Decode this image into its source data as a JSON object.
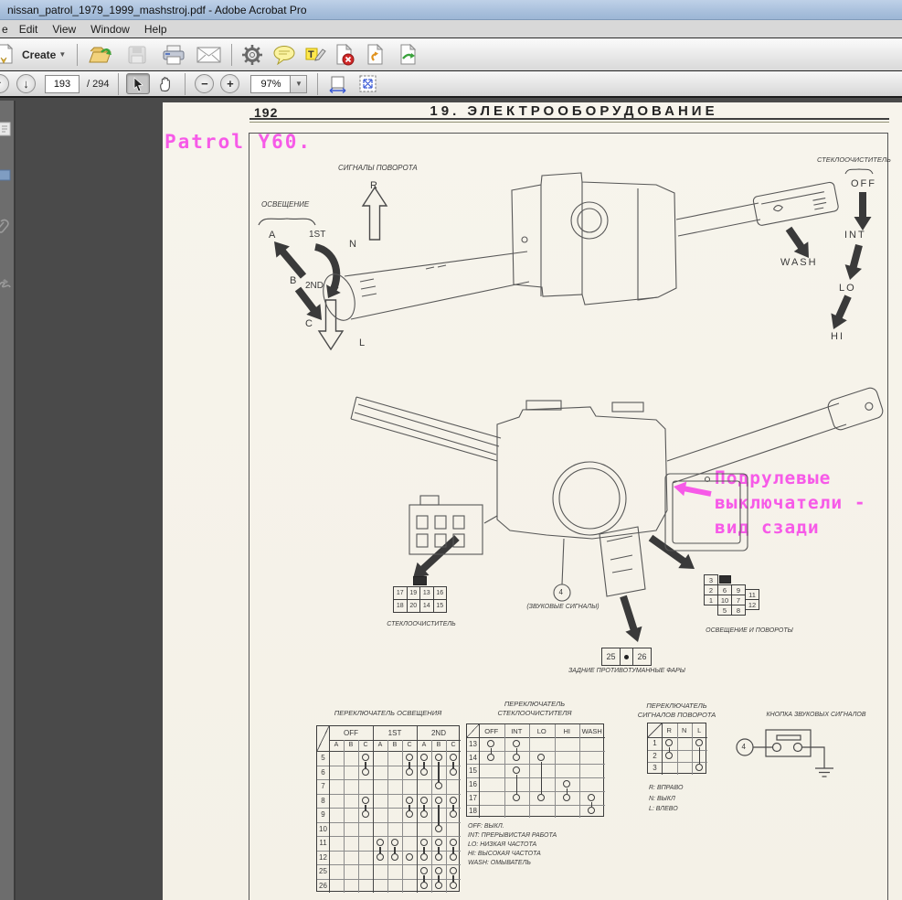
{
  "window": {
    "title": "nissan_patrol_1979_1999_mashstroj.pdf - Adobe Acrobat Pro"
  },
  "menu": {
    "items": [
      "e",
      "Edit",
      "View",
      "Window",
      "Help"
    ]
  },
  "toolbar": {
    "create_label": "Create",
    "page_current": "193",
    "page_total": "/ 294",
    "zoom_value": "97%"
  },
  "pdf": {
    "page_number": "192",
    "chapter": "19. ЭЛЕКТРООБОРУДОВАНИЕ",
    "pink": {
      "model": "Patrol Y60.",
      "callout": [
        "Подрулевые",
        "выключатели -",
        "вид сзади"
      ],
      "color": "#f75ae8"
    },
    "diagram": {
      "turn_title": "СИГНАЛЫ ПОВОРОТА",
      "r": "R",
      "n": "N",
      "l": "L",
      "light_title": "ОСВЕЩЕНИЕ",
      "a": "A",
      "first": "1ST",
      "b": "B",
      "second": "2ND",
      "c": "C",
      "wiper_title": "СТЕКЛООЧИСТИТЕЛЬ",
      "off": "OFF",
      "int": "INT",
      "lo": "LO",
      "hi": "HI",
      "wash": "WASH"
    },
    "connectors": {
      "wiper": {
        "label": "СТЕКЛООЧИСТИТЕЛЬ",
        "pins": [
          [
            "17",
            "19",
            "13",
            "16"
          ],
          [
            "18",
            "20",
            "14",
            "15"
          ]
        ]
      },
      "horn": {
        "pin": "4",
        "note": "(ЗВУКОВЫЕ СИГНАЛЫ)"
      },
      "fog": {
        "label": "ЗАДНИЕ ПРОТИВОТУМАННЫЕ ФАРЫ",
        "p1": "25",
        "p2": "26"
      },
      "light": {
        "label": "ОСВЕЩЕНИЕ И ПОВОРОТЫ",
        "pins": {
          "p3": "3",
          "p2": "2",
          "p6": "6",
          "p9": "9",
          "p1": "1",
          "p10": "10",
          "p7": "7",
          "p11": "11",
          "p12": "12",
          "p5": "5",
          "p8": "8"
        }
      }
    },
    "tables": {
      "light": {
        "title": "ПЕРЕКЛЮЧАТЕЛЬ ОСВЕЩЕНИЯ",
        "groups": [
          "OFF",
          "1ST",
          "2ND"
        ],
        "subcols": [
          "A",
          "B",
          "C",
          "A",
          "B",
          "C",
          "A",
          "B",
          "C"
        ],
        "rows": [
          {
            "label": "5",
            "marks": [
              0,
              0,
              1,
              0,
              0,
              1,
              1,
              1,
              1
            ]
          },
          {
            "label": "6",
            "marks": [
              0,
              0,
              1,
              0,
              0,
              1,
              1,
              0,
              1
            ]
          },
          {
            "label": "7",
            "marks": [
              0,
              0,
              0,
              0,
              0,
              0,
              0,
              1,
              0
            ]
          },
          {
            "label": "8",
            "marks": [
              0,
              0,
              1,
              0,
              0,
              1,
              1,
              1,
              1
            ]
          },
          {
            "label": "9",
            "marks": [
              0,
              0,
              1,
              0,
              0,
              1,
              1,
              0,
              1
            ]
          },
          {
            "label": "10",
            "marks": [
              0,
              0,
              0,
              0,
              0,
              0,
              0,
              1,
              0
            ]
          },
          {
            "label": "11",
            "marks": [
              0,
              0,
              0,
              1,
              1,
              0,
              1,
              1,
              1
            ]
          },
          {
            "label": "12",
            "marks": [
              0,
              0,
              0,
              1,
              1,
              1,
              1,
              1,
              1
            ]
          },
          {
            "label": "25",
            "marks": [
              0,
              0,
              0,
              0,
              0,
              0,
              1,
              1,
              1
            ]
          },
          {
            "label": "26",
            "marks": [
              0,
              0,
              0,
              0,
              0,
              0,
              1,
              1,
              1
            ]
          }
        ],
        "links": [
          [
            2,
            0,
            1
          ],
          [
            5,
            0,
            1
          ],
          [
            6,
            0,
            1
          ],
          [
            8,
            0,
            1
          ],
          [
            7,
            0,
            2
          ],
          [
            2,
            3,
            4
          ],
          [
            5,
            3,
            4
          ],
          [
            6,
            3,
            4
          ],
          [
            8,
            3,
            4
          ],
          [
            7,
            3,
            5
          ],
          [
            3,
            6,
            7
          ],
          [
            4,
            6,
            7
          ],
          [
            6,
            6,
            7
          ],
          [
            7,
            6,
            7
          ],
          [
            8,
            6,
            7
          ],
          [
            6,
            8,
            9
          ],
          [
            7,
            8,
            9
          ],
          [
            8,
            8,
            9
          ]
        ]
      },
      "wiper": {
        "title": [
          "ПЕРЕКЛЮЧАТЕЛЬ",
          "СТЕКЛООЧИСТИТЕЛЯ"
        ],
        "cols": [
          "OFF",
          "INT",
          "LO",
          "HI",
          "WASH"
        ],
        "rows": [
          {
            "label": "13",
            "marks": [
              1,
              1,
              0,
              0,
              0
            ]
          },
          {
            "label": "14",
            "marks": [
              1,
              1,
              1,
              0,
              0
            ]
          },
          {
            "label": "15",
            "marks": [
              0,
              1,
              0,
              0,
              0
            ]
          },
          {
            "label": "16",
            "marks": [
              0,
              0,
              0,
              1,
              0
            ]
          },
          {
            "label": "17",
            "marks": [
              0,
              1,
              1,
              1,
              1
            ]
          },
          {
            "label": "18",
            "marks": [
              0,
              0,
              0,
              0,
              1
            ]
          }
        ],
        "links": [
          [
            0,
            0,
            1
          ],
          [
            1,
            0,
            1
          ],
          [
            2,
            1,
            4
          ],
          [
            1,
            2,
            4
          ],
          [
            3,
            3,
            4
          ],
          [
            4,
            4,
            5
          ]
        ],
        "legend": [
          "OFF: ВЫКЛ.",
          "INT: ПРЕРЫВИСТАЯ РАБОТА",
          "LO: НИЗКАЯ ЧАСТОТА",
          "HI: ВЫСОКАЯ ЧАСТОТА",
          "WASH: ОМЫВАТЕЛЬ"
        ]
      },
      "turn": {
        "title": [
          "ПЕРЕКЛЮЧАТЕЛЬ",
          "СИГНАЛОВ ПОВОРОТА"
        ],
        "cols": [
          "R",
          "N",
          "L"
        ],
        "rows": [
          {
            "label": "1",
            "marks": [
              1,
              0,
              1
            ]
          },
          {
            "label": "2",
            "marks": [
              1,
              0,
              0
            ]
          },
          {
            "label": "3",
            "marks": [
              0,
              0,
              1
            ]
          }
        ],
        "links": [
          [
            0,
            0,
            1
          ],
          [
            2,
            0,
            2
          ]
        ],
        "legend": [
          "R: ВПРАВО",
          "N: ВЫКЛ",
          "L: ВЛЕВО"
        ]
      },
      "horn_title": "КНОПКА ЗВУКОВЫХ СИГНАЛОВ"
    }
  }
}
